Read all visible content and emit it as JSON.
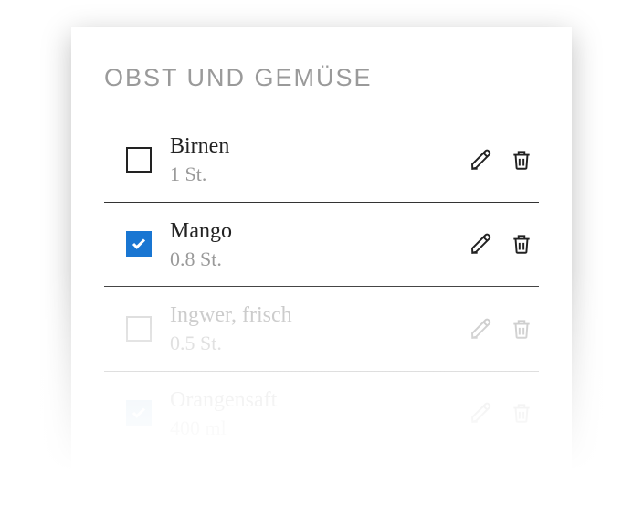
{
  "category": "OBST UND GEMÜSE",
  "items": [
    {
      "name": "Birnen",
      "qty": "1 St.",
      "checked": false,
      "fade": ""
    },
    {
      "name": "Mango",
      "qty": "0.8 St.",
      "checked": true,
      "fade": ""
    },
    {
      "name": "Ingwer, frisch",
      "qty": "0.5 St.",
      "checked": false,
      "fade": "faded"
    },
    {
      "name": "Orangensaft",
      "qty": "400 ml",
      "checked": true,
      "fade": "very-faded"
    }
  ]
}
